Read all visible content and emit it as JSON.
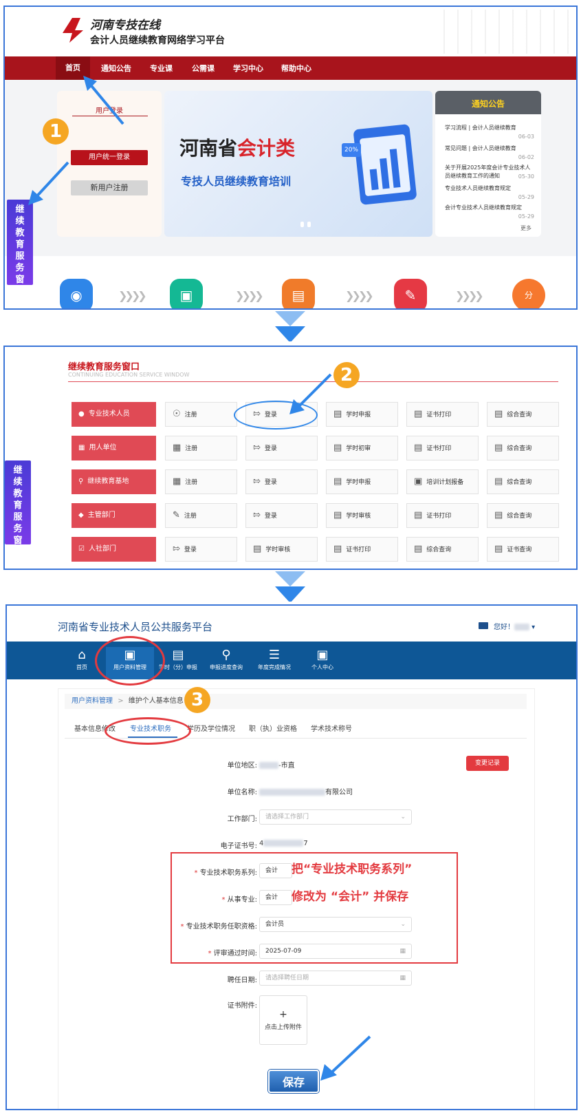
{
  "side_tab": "继续教育服务窗口",
  "steps": [
    "1",
    "2",
    "3"
  ],
  "p1": {
    "logo_title": "河南专技在线",
    "logo_subtitle": "会计人员继续教育网络学习平台",
    "nav": [
      "首页",
      "通知公告",
      "专业课",
      "公需课",
      "学习中心",
      "帮助中心"
    ],
    "login_box_title": "用户登录",
    "login_btn": "用户统一登录",
    "register_btn": "新用户注册",
    "banner_line1a": "河南省",
    "banner_line1b": "会计类",
    "banner_line2": "专技人员继续教育培训",
    "banner_badge": "20%",
    "notice_title": "通知公告",
    "notices": [
      {
        "text": "学习流程 | 会计人员继续教育",
        "date": "06-03"
      },
      {
        "text": "常见问题 | 会计人员继续教育",
        "date": "06-02"
      },
      {
        "text": "关于开展2025年度会计专业技术人员继续教育工作的通知",
        "date": "05-30"
      },
      {
        "text": "专业技术人员继续教育规定",
        "date": "05-29"
      },
      {
        "text": "会计专业技术人员继续教育规定",
        "date": "05-29"
      }
    ],
    "notice_more": "更多",
    "icon_last": "分"
  },
  "p2": {
    "title": "继续教育服务窗口",
    "subtitle": "CONTINUING EDUCATION SERVICE WINDOW",
    "rows": [
      {
        "label": "专业技术人员",
        "cells": [
          "注册",
          "登录",
          "学时申报",
          "证书打印",
          "综合查询"
        ]
      },
      {
        "label": "用人单位",
        "cells": [
          "注册",
          "登录",
          "学时初审",
          "证书打印",
          "综合查询"
        ]
      },
      {
        "label": "继续教育基地",
        "cells": [
          "注册",
          "登录",
          "学时申报",
          "培训计划报备",
          "综合查询"
        ]
      },
      {
        "label": "主管部门",
        "cells": [
          "注册",
          "登录",
          "学时审核",
          "证书打印",
          "综合查询"
        ]
      },
      {
        "label": "人社部门",
        "cells": [
          "登录",
          "学时审核",
          "证书打印",
          "综合查询",
          "证书查询"
        ]
      }
    ]
  },
  "p3": {
    "platform_title": "河南省专业技术人员公共服务平台",
    "greeting": "您好！",
    "nav": [
      "首页",
      "用户资料管理",
      "学时（分）申报",
      "申报进度查询",
      "年度完成情况",
      "个人中心"
    ],
    "breadcrumb_link": "用户资料管理",
    "breadcrumb_sep": ">",
    "breadcrumb_current": "维护个人基本信息",
    "tabs": [
      "基本信息修改",
      "专业技术职务",
      "学历及学位情况",
      "职（执）业资格",
      "学术技术称号"
    ],
    "change_record_btn": "变更记录",
    "fields": [
      {
        "label": "单位地区:",
        "value": "-市直"
      },
      {
        "label": "单位名称:",
        "value": "有限公司"
      },
      {
        "label": "工作部门:",
        "placeholder": "请选择工作部门"
      },
      {
        "label": "电子证书号:",
        "value_prefix": "4",
        "value_suffix": "7"
      },
      {
        "label": "专业技术职务系列:",
        "value": "会计",
        "required": true
      },
      {
        "label": "从事专业:",
        "value": "会计",
        "required": true
      },
      {
        "label": "专业技术职务任职资格:",
        "value": "会计员",
        "required": true
      },
      {
        "label": "评审通过时间:",
        "value": "2025-07-09",
        "required": true
      },
      {
        "label": "聘任日期:",
        "placeholder": "请选择聘任日期"
      },
      {
        "label": "证书附件:"
      }
    ],
    "upload_plus": "+",
    "upload_text": "点击上传附件",
    "callout_line1": "把“专业技术职务系列”",
    "callout_line2": "修改为 “会计” 并保存",
    "save_btn": "保存"
  },
  "colors": {
    "brand_red": "#a8141c",
    "panel_border": "#3a75d8",
    "nav_blue": "#0e5796",
    "row_red": "#e04a55",
    "step_orange": "#f5a623",
    "arrow_blue": "#2f86e8"
  }
}
